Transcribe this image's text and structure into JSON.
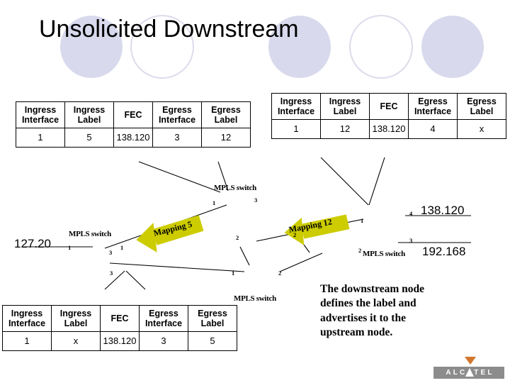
{
  "slide": {
    "title": "Unsolicited Downstream",
    "background_color": "#ffffff",
    "circle_fill_color": "#d8d9ec",
    "arrow_color": "#cccc00"
  },
  "tables": {
    "headers": [
      "Ingress Interface",
      "Ingress Label",
      "FEC",
      "Egress Interface",
      "Egress Label"
    ],
    "header_parts": [
      [
        "Ingress",
        "Interface"
      ],
      [
        "Ingress",
        "Label"
      ],
      [
        "FEC",
        ""
      ],
      [
        "Egress",
        "Interface"
      ],
      [
        "Egress",
        "Label"
      ]
    ],
    "top_left": {
      "name": "upstream-lfib",
      "values": [
        "1",
        "5",
        "138.120",
        "3",
        "12"
      ]
    },
    "top_right": {
      "name": "downstream-lfib",
      "values": [
        "1",
        "12",
        "138.120",
        "4",
        "x"
      ]
    },
    "bottom": {
      "name": "edge-lfib",
      "values": [
        "1",
        "x",
        "138.120",
        "3",
        "5"
      ]
    }
  },
  "diagram": {
    "switch_label": "MPLS switch",
    "switches": [
      {
        "label": "MPLS switch"
      },
      {
        "label": "MPLS switch"
      },
      {
        "label": "MPLS switch"
      },
      {
        "label": "MPLS switch"
      }
    ],
    "networks": [
      {
        "address": "127.20"
      },
      {
        "address": "138.120"
      },
      {
        "address": "192.168"
      }
    ],
    "port_numbers": [
      "1",
      "3",
      "1",
      "3",
      "2",
      "1",
      "2",
      "3",
      "2",
      "1",
      "2",
      "4",
      "3",
      "1"
    ],
    "arrows": [
      {
        "label": "Mapping 5"
      },
      {
        "label": "Mapping 12"
      }
    ]
  },
  "note": {
    "lines": [
      "The downstream node",
      "defines the label and",
      "advertises it to the",
      "upstream node."
    ],
    "text": "The downstream node defines the label and advertises it to the upstream node."
  },
  "logo": {
    "wordmark": "ALCATEL",
    "bar_color": "#8c8c8c",
    "triangle_color": "#d2762c"
  }
}
